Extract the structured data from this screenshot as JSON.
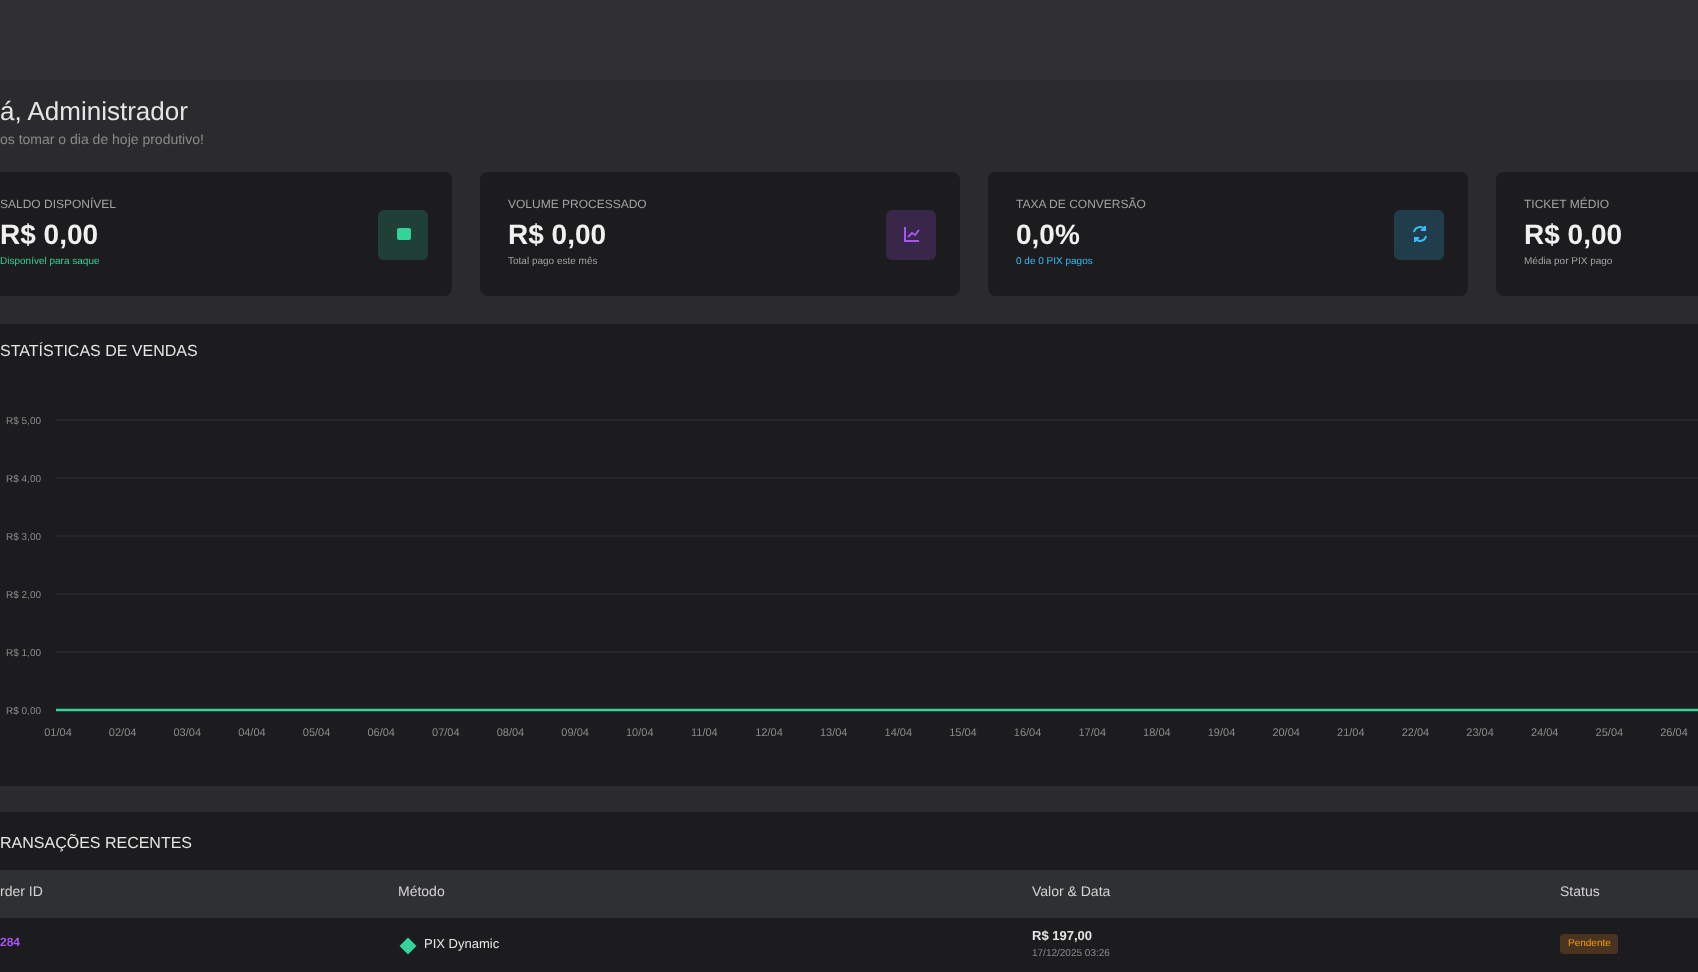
{
  "greeting": {
    "title": "á, Administrador",
    "subtitle": "os tomar o dia de hoje produtivo!"
  },
  "cards": [
    {
      "label": "SALDO DISPONÍVEL",
      "value": "R$ 0,00",
      "note": "Disponível para saque",
      "kind": "wallet"
    },
    {
      "label": "VOLUME PROCESSADO",
      "value": "R$ 0,00",
      "note": "Total pago este mês",
      "kind": "chart"
    },
    {
      "label": "TAXA DE CONVERSÃO",
      "value": "0,0%",
      "note": "0 de 0 PIX pagos",
      "kind": "refresh"
    },
    {
      "label": "TICKET MÉDIO",
      "value": "R$ 0,00",
      "note": "Média por PIX pago",
      "kind": "plain"
    }
  ],
  "sales_chart": {
    "title": "STATÍSTICAS DE VENDAS",
    "x_axis_labels": [
      "01/04",
      "02/04",
      "03/04",
      "04/04",
      "05/04",
      "06/04",
      "07/04",
      "08/04",
      "09/04",
      "10/04",
      "11/04",
      "12/04",
      "13/04",
      "14/04",
      "15/04",
      "16/04",
      "17/04",
      "18/04",
      "19/04",
      "20/04",
      "21/04",
      "22/04",
      "23/04",
      "24/04",
      "25/04",
      "26/04"
    ],
    "y_axis_labels": [
      "R$ 5,00",
      "R$ 4,00",
      "R$ 3,00",
      "R$ 2,00",
      "R$ 1,00",
      "R$ 0,00"
    ]
  },
  "transactions": {
    "title": "RANSAÇÕES RECENTES",
    "columns": [
      "rder ID",
      "Método",
      "Valor & Data",
      "Status"
    ],
    "rows": [
      {
        "order_id": "284",
        "method": "PIX Dynamic",
        "amount": "R$ 197,00",
        "date": "17/12/2025 03:26",
        "status": "Pendente"
      }
    ]
  }
}
